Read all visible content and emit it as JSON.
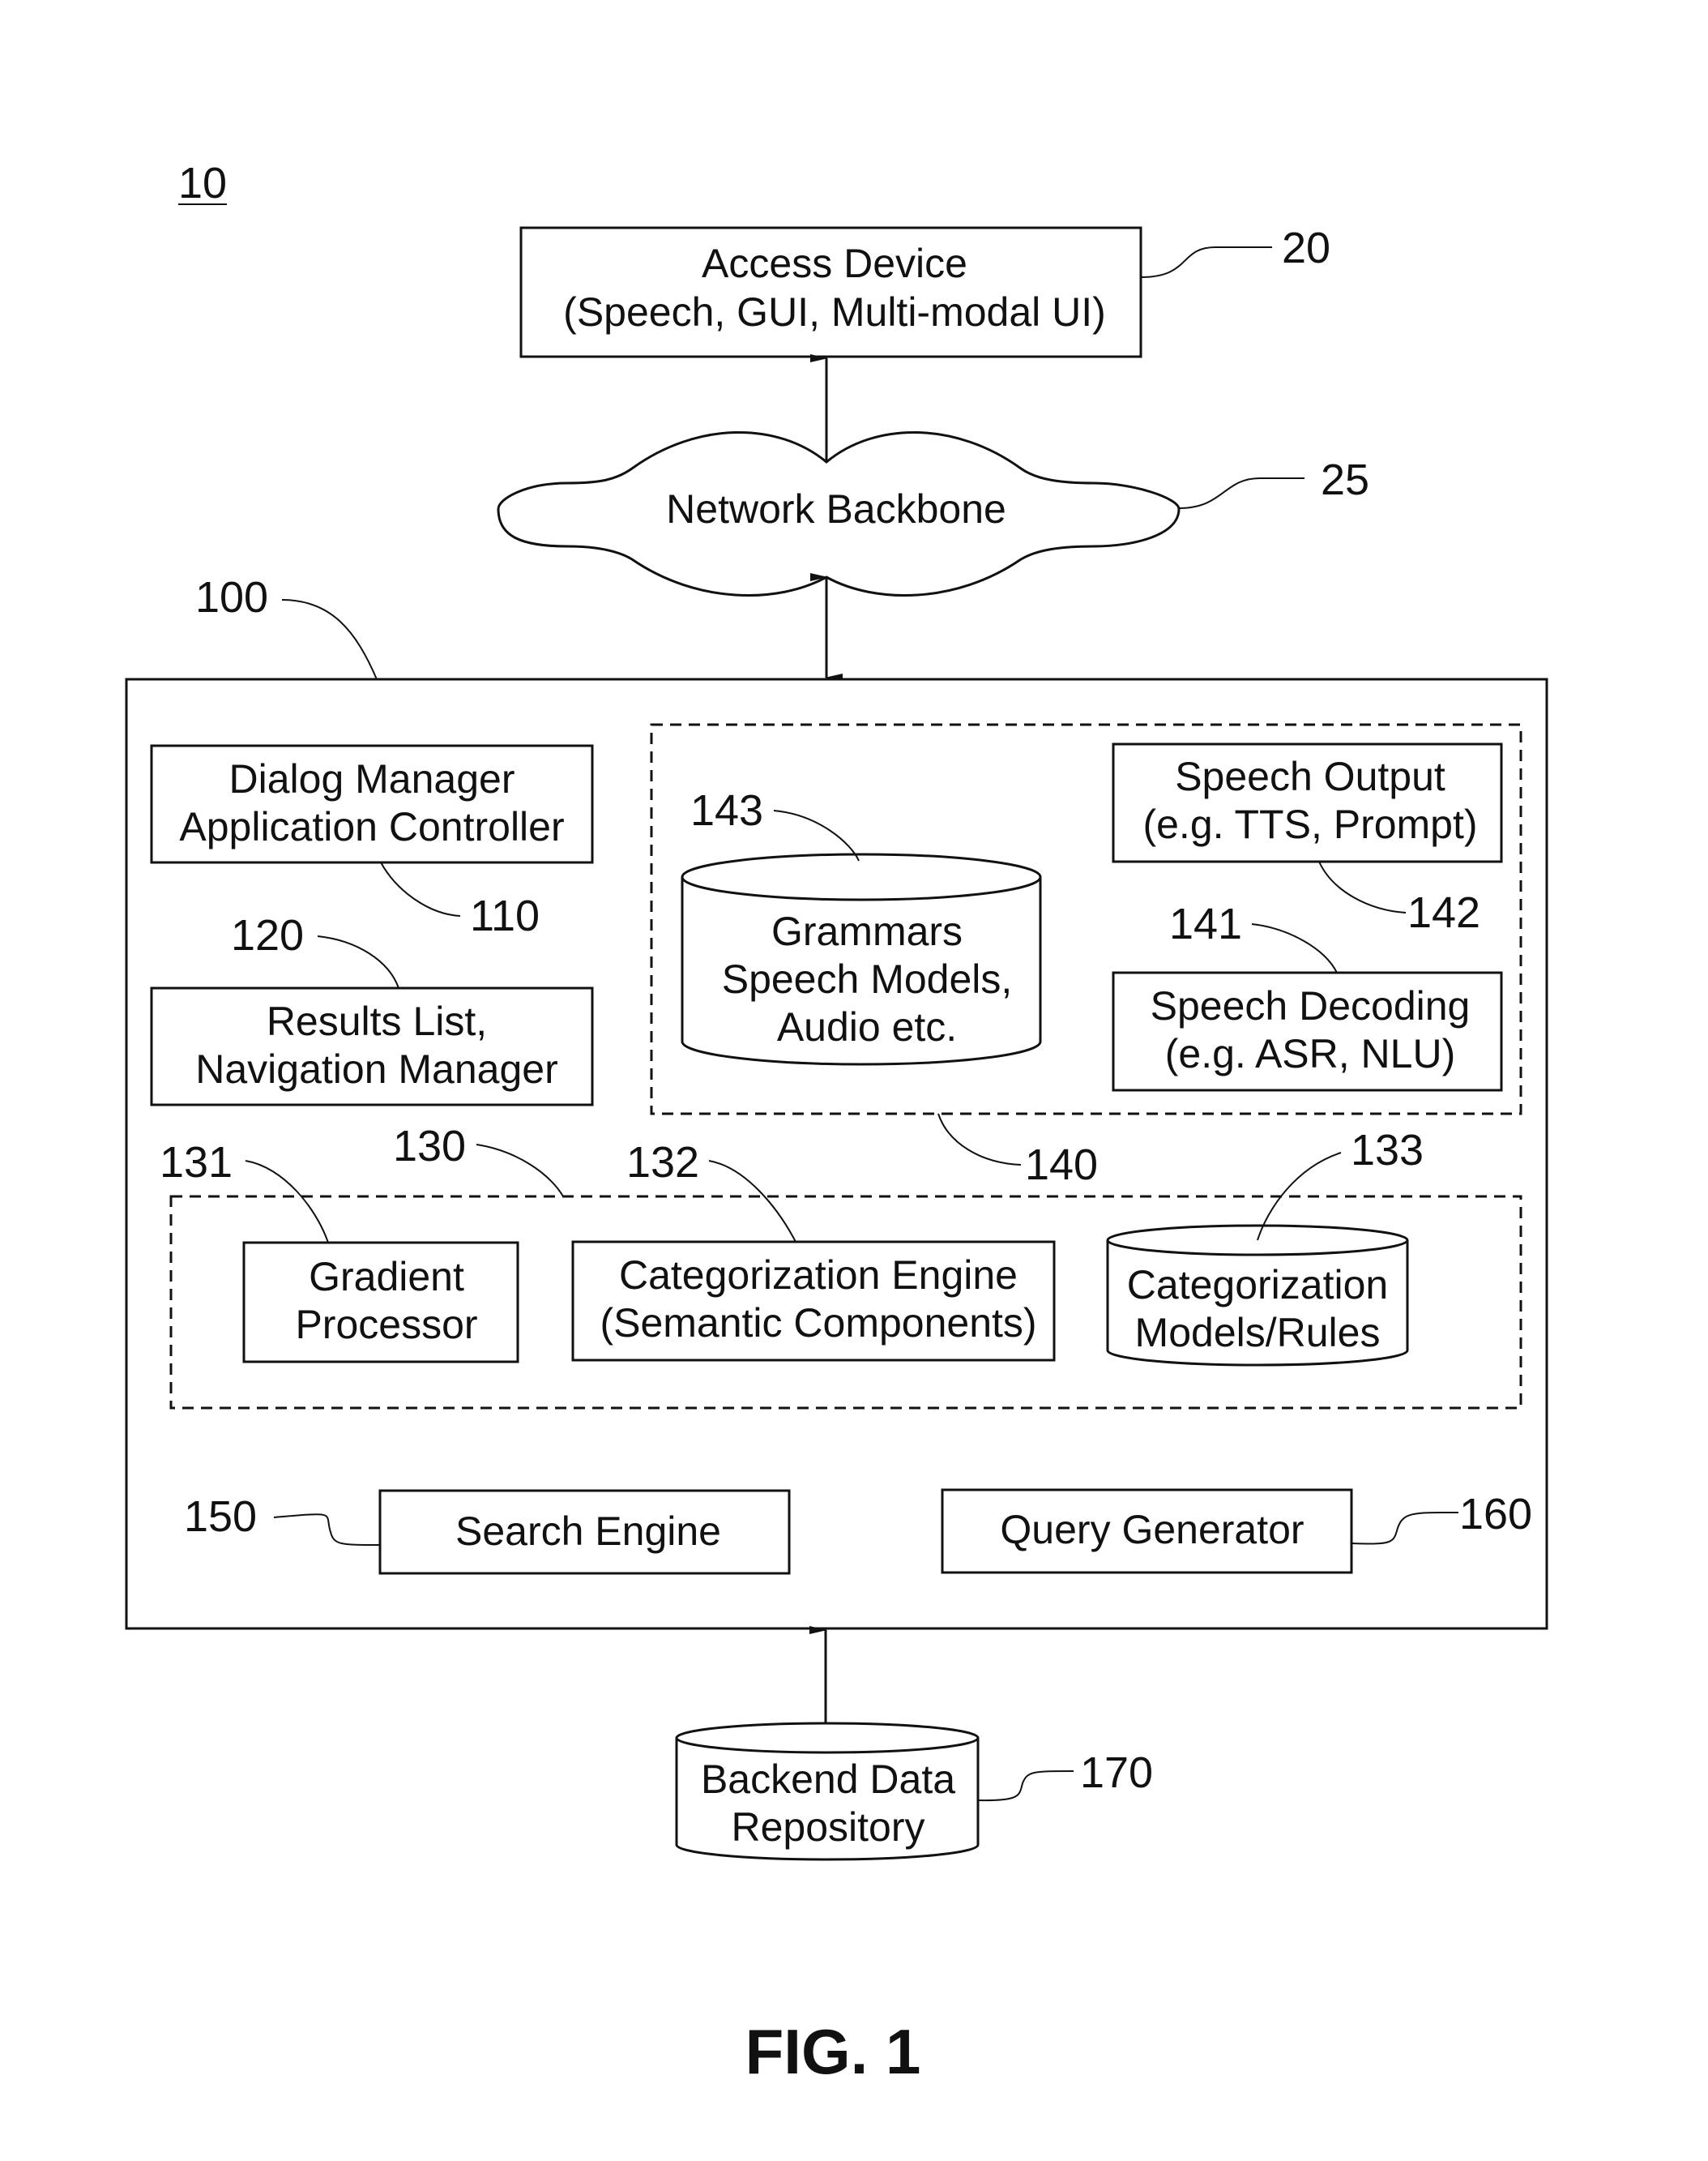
{
  "figure": {
    "title": "FIG. 1",
    "system_ref": "10"
  },
  "access_device": {
    "ref": "20",
    "line1": "Access Device",
    "line2": "(Speech, GUI, Multi-modal UI)"
  },
  "network": {
    "ref": "25",
    "label": "Network Backbone"
  },
  "main_system": {
    "ref": "100"
  },
  "dialog_manager": {
    "ref": "110",
    "line1": "Dialog Manager",
    "line2": "Application Controller"
  },
  "results_list": {
    "ref": "120",
    "line1": "Results List,",
    "line2": "Navigation Manager"
  },
  "speech_group": {
    "ref": "140"
  },
  "grammars_store": {
    "ref": "143",
    "line1": "Grammars",
    "line2": "Speech Models,",
    "line3": "Audio etc."
  },
  "speech_output": {
    "ref": "142",
    "line1": "Speech Output",
    "line2": "(e.g. TTS, Prompt)"
  },
  "speech_decoding": {
    "ref": "141",
    "line1": "Speech Decoding",
    "line2": "(e.g. ASR, NLU)"
  },
  "categorization_group": {
    "ref": "130"
  },
  "gradient_processor": {
    "ref": "131",
    "line1": "Gradient",
    "line2": "Processor"
  },
  "categorization_engine": {
    "ref": "132",
    "line1": "Categorization Engine",
    "line2": "(Semantic Components)"
  },
  "categorization_models": {
    "ref": "133",
    "line1": "Categorization",
    "line2": "Models/Rules"
  },
  "search_engine": {
    "ref": "150",
    "label": "Search Engine"
  },
  "query_generator": {
    "ref": "160",
    "label": "Query Generator"
  },
  "backend_repository": {
    "ref": "170",
    "line1": "Backend Data",
    "line2": "Repository"
  }
}
